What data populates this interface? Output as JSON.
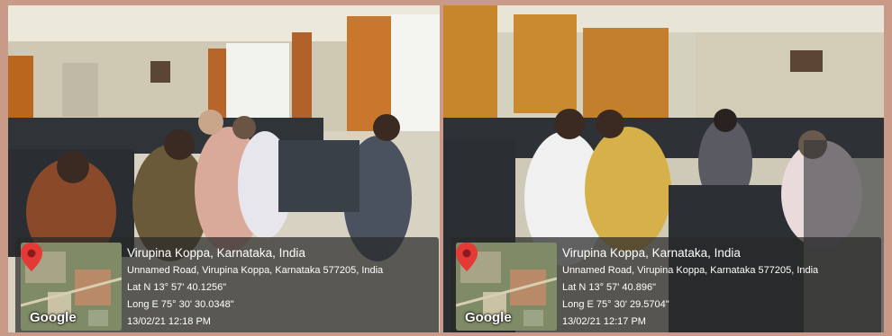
{
  "photos": [
    {
      "location": "Virupina Koppa, Karnataka, India",
      "address": "Unnamed Road, Virupina Koppa, Karnataka 577205, India",
      "lat": "Lat N 13° 57' 40.1256\"",
      "long": "Long E 75° 30' 30.0348\"",
      "datetime": "13/02/21 12:18 PM",
      "map_label": "Google",
      "map_icon": "location-pin-icon"
    },
    {
      "location": "Virupina Koppa, Karnataka, India",
      "address": "Unnamed Road, Virupina Koppa, Karnataka 577205, India",
      "lat": "Lat N 13° 57' 40.896\"",
      "long": "Long E 75° 30' 29.5704\"",
      "datetime": "13/02/21 12:17 PM",
      "map_label": "Google",
      "map_icon": "location-pin-icon"
    }
  ],
  "colors": {
    "frame": "#c99a88",
    "overlay": "#282828",
    "pin": "#e53935"
  }
}
